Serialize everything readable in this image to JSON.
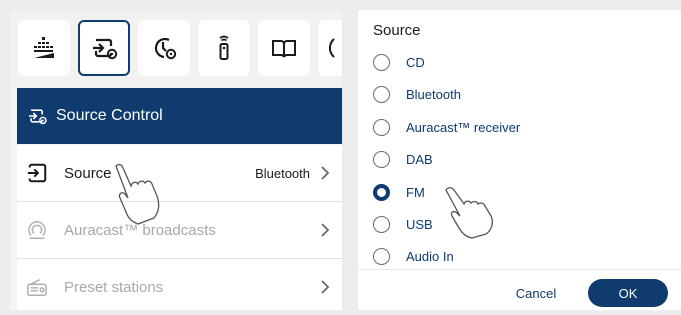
{
  "left_panel": {
    "toolbar": {
      "icons": [
        "equalizer-icon",
        "source-settings-icon",
        "timer-settings-icon",
        "remote-control-icon",
        "book-icon",
        "partial-icon"
      ],
      "active_index": 1
    },
    "header": {
      "title": "Source Control",
      "icon": "source-settings-icon"
    },
    "rows": [
      {
        "label": "Source",
        "value": "Bluetooth",
        "icon": "source-icon",
        "enabled": true
      },
      {
        "label": "Auracast™ broadcasts",
        "value": "",
        "icon": "auracast-icon",
        "enabled": false
      },
      {
        "label": "Preset stations",
        "value": "",
        "icon": "radio-icon",
        "enabled": false
      }
    ]
  },
  "dialog": {
    "title": "Source",
    "options": [
      {
        "label": "CD",
        "selected": false
      },
      {
        "label": "Bluetooth",
        "selected": false
      },
      {
        "label": "Auracast™ receiver",
        "selected": false
      },
      {
        "label": "DAB",
        "selected": false
      },
      {
        "label": "FM",
        "selected": true
      },
      {
        "label": "USB",
        "selected": false
      },
      {
        "label": "Audio In",
        "selected": false
      }
    ],
    "cancel_label": "Cancel",
    "ok_label": "OK"
  },
  "colors": {
    "accent": "#0f3b6e",
    "disabled_text": "#a8a8a8"
  }
}
